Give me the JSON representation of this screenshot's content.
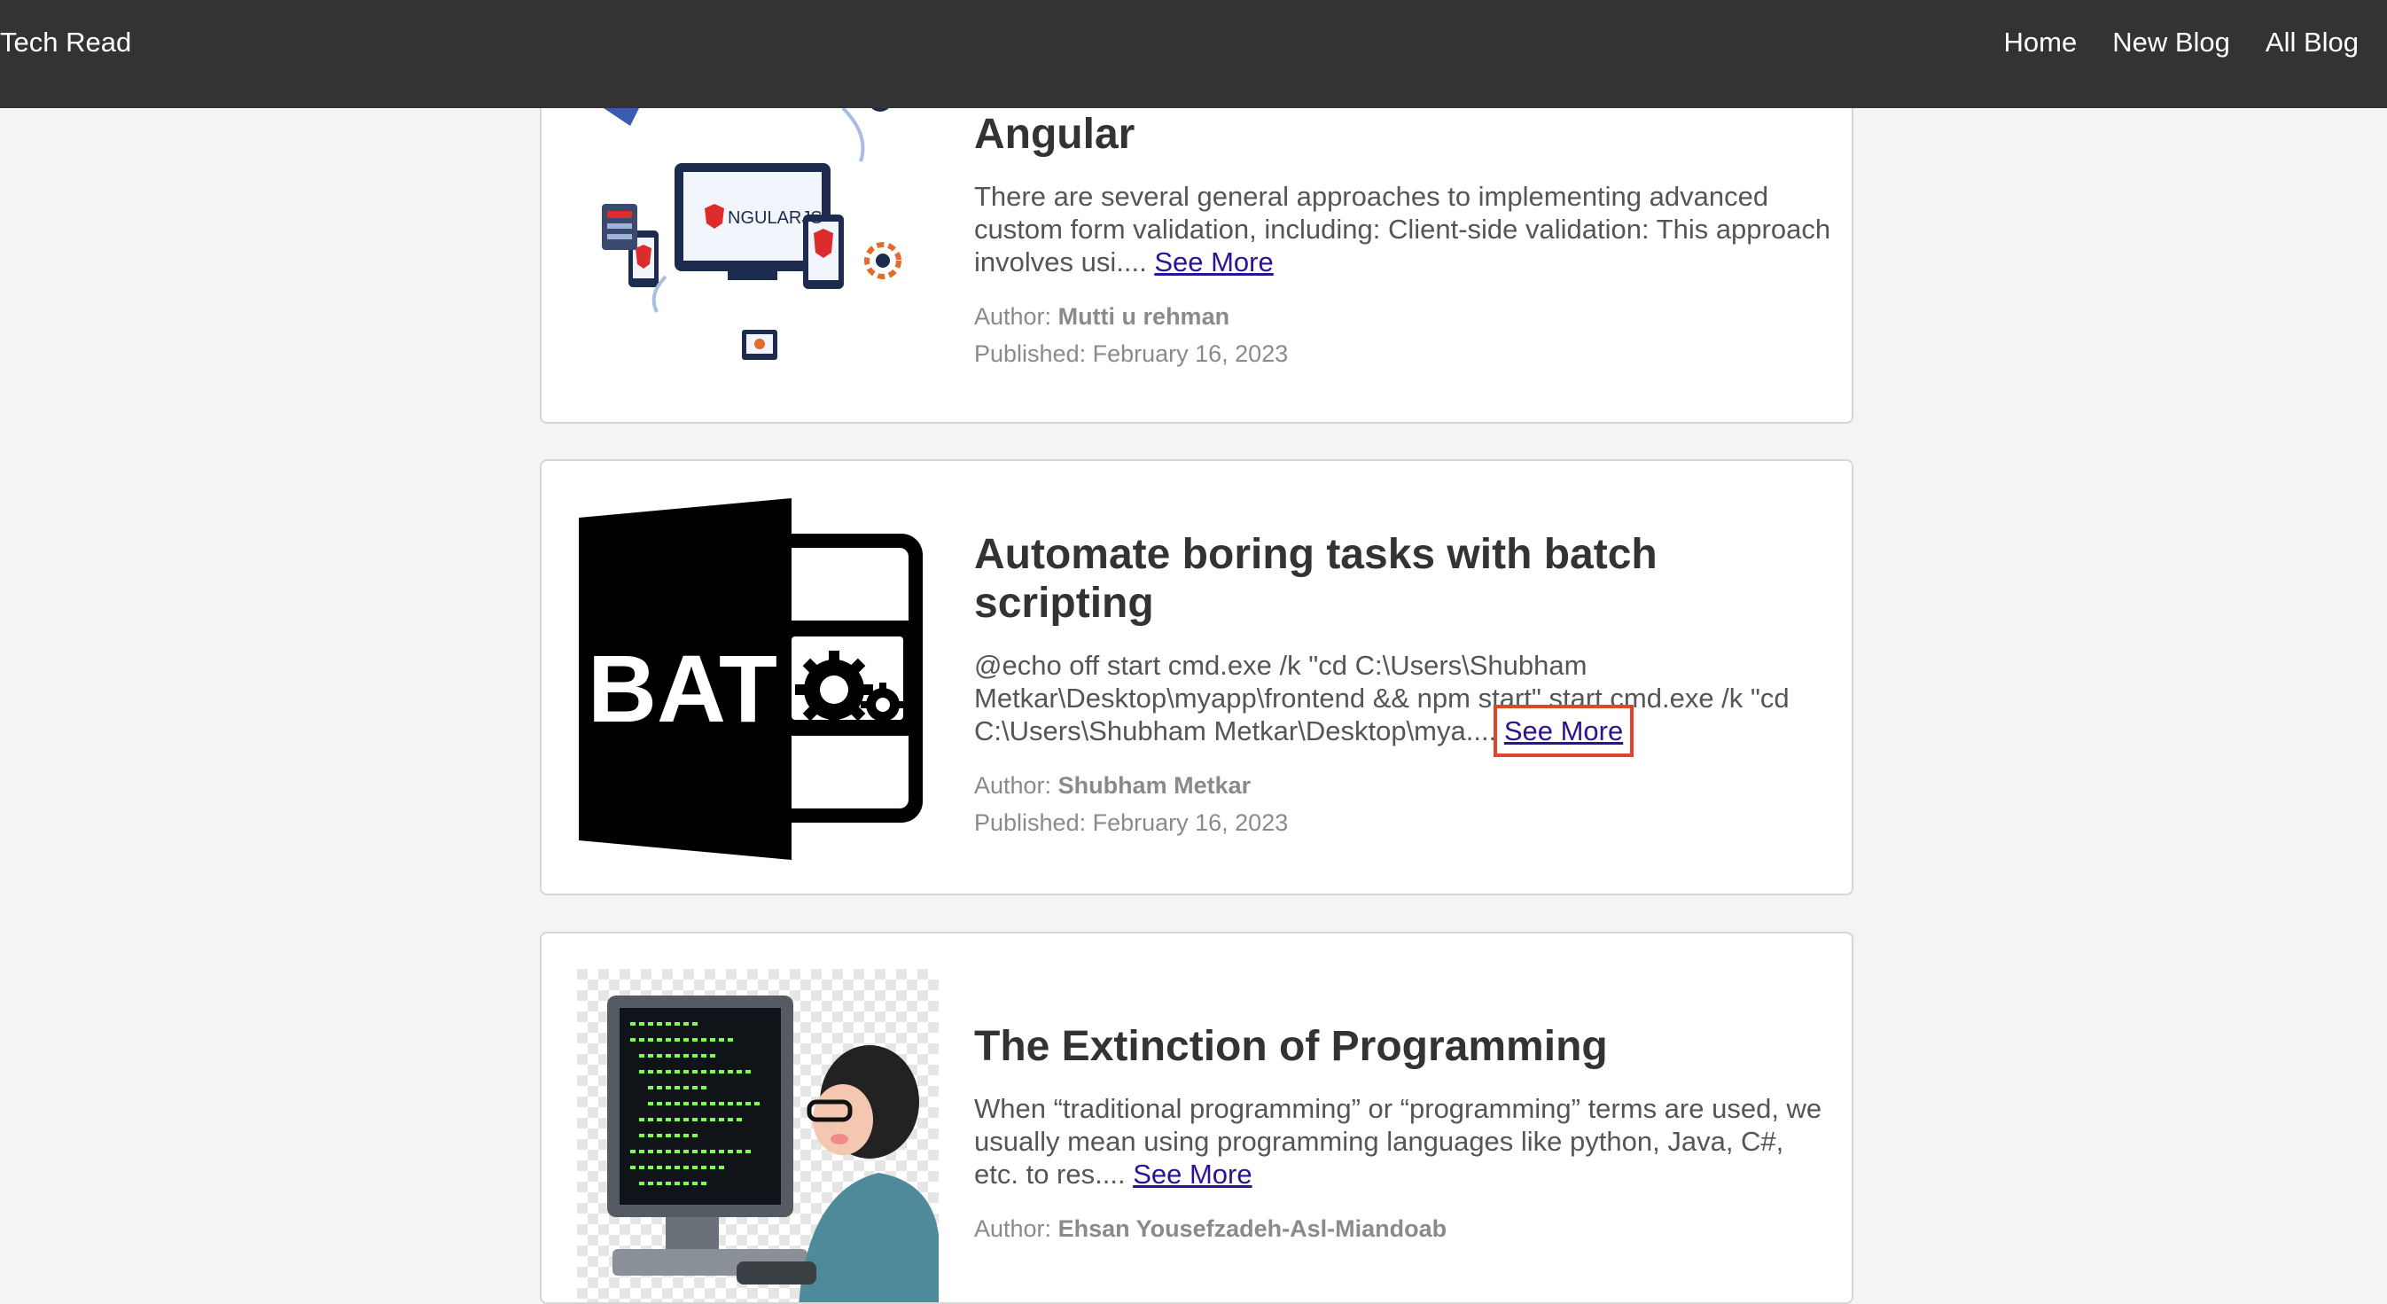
{
  "navbar": {
    "brand": "Tech Read",
    "links": [
      "Home",
      "New Blog",
      "All Blog"
    ]
  },
  "posts": [
    {
      "image_icon": "angular-devices-illustration",
      "image_text": "NGULARJS",
      "title": "Angular",
      "excerpt": "There are several general approaches to implementing advanced custom form validation, including: Client-side validation: This approach involves usi....",
      "see_more": "See More",
      "author_label": "Author:",
      "author": "Mutti u rehman",
      "published": "Published: February 16, 2023"
    },
    {
      "image_icon": "bat-file-icon",
      "image_text": "BAT",
      "title": "Automate boring tasks with batch scripting",
      "excerpt": "@echo off start cmd.exe /k \"cd C:\\Users\\Shubham Metkar\\Desktop\\myapp\\frontend && npm start\" start cmd.exe /k \"cd C:\\Users\\Shubham Metkar\\Desktop\\mya....",
      "see_more": "See More",
      "author_label": "Author:",
      "author": "Shubham Metkar",
      "published": "Published: February 16, 2023"
    },
    {
      "image_icon": "programmer-at-computer-illustration",
      "title": "The Extinction of Programming",
      "excerpt": "When “traditional programming” or “programming” terms are used, we usually mean using programming languages like python, Java, C#, etc. to res....",
      "see_more": "See More",
      "author_label": "Author:",
      "author": "Ehsan Yousefzadeh-Asl-Miandoab",
      "published": ""
    }
  ],
  "colors": {
    "navbar": "#333333",
    "link": "#2c1294",
    "highlight": "#e0452e",
    "angular_red": "#dd2c2c",
    "terminal_green": "#7cff4a"
  }
}
